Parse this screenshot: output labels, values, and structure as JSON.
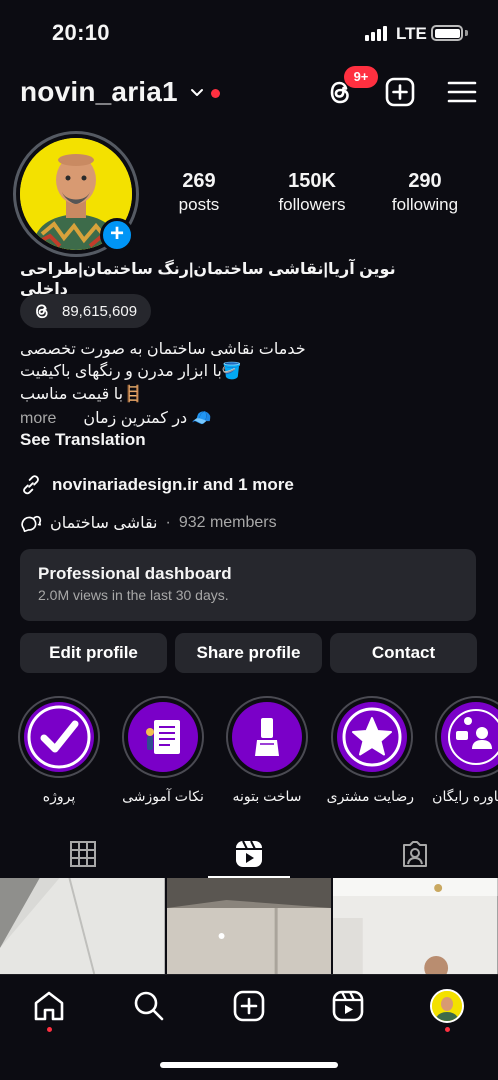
{
  "status_bar": {
    "time": "20:10",
    "network": "LTE"
  },
  "header": {
    "username": "novin_aria1",
    "notification_badge": "9+"
  },
  "profile": {
    "stats": [
      {
        "value": "269",
        "label": "posts"
      },
      {
        "value": "150K",
        "label": "followers"
      },
      {
        "value": "290",
        "label": "following"
      }
    ],
    "display_name": "نوین آریا|نقاشی ساختمان|رنگ ساختمان|طراحی داخلی",
    "threads_count": "89,615,609",
    "bio_lines": [
      "خدمات نقاشی ساختمان به صورت تخصصی",
      "🪣با ابزار مدرن و رنگهای باکیفیت",
      "🪜با قیمت مناسب",
      "🧢 در کمترین زمان"
    ],
    "more_label": "more",
    "see_translation": "See Translation",
    "link_text": "novinariadesign.ir and 1 more",
    "channel_name": "نقاشی ساختمان",
    "channel_members": "932 members"
  },
  "dashboard": {
    "title": "Professional dashboard",
    "subtitle": "2.0M views in the last 30 days."
  },
  "actions": {
    "edit": "Edit profile",
    "share": "Share profile",
    "contact": "Contact"
  },
  "highlights": [
    {
      "label": "پروژه",
      "icon": "checkmark-icon"
    },
    {
      "label": "نکات آموزشی",
      "icon": "tips-document-icon"
    },
    {
      "label": "ساخت بتونه",
      "icon": "putty-knife-icon"
    },
    {
      "label": "رضایت مشتری",
      "icon": "star-icon"
    },
    {
      "label": "مشاوره رایگان",
      "icon": "consultation-icon"
    }
  ],
  "colors": {
    "background": "#0c0c12",
    "card": "#26272d",
    "accent_blue": "#0095f6",
    "badge_red": "#ff3040",
    "highlight_purple": "#7a00c8"
  }
}
